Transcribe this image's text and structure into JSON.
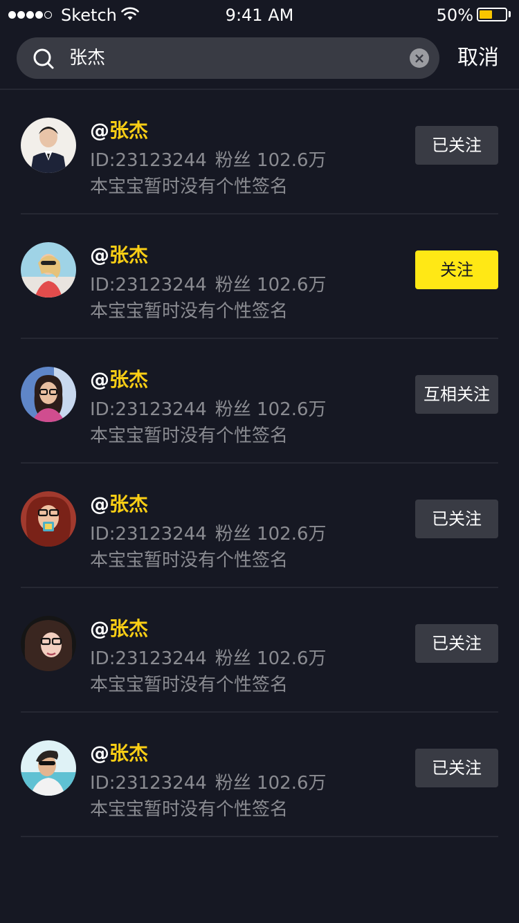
{
  "status_bar": {
    "carrier": "Sketch",
    "time": "9:41 AM",
    "battery_percent": "50%",
    "battery_level": 0.5,
    "signal_bars_filled": 4,
    "signal_bars_total": 5
  },
  "search": {
    "query": "张杰",
    "cancel_label": "取消",
    "icons": {
      "search": "search-icon",
      "clear": "clear-icon"
    }
  },
  "colors": {
    "background": "#161823",
    "accent_yellow": "#FFE815",
    "name_yellow": "#FACE15",
    "button_gray": "#393B44",
    "meta_gray": "#8A8B91"
  },
  "users": [
    {
      "at": "@",
      "name": "张杰",
      "id_text": "ID:23123244",
      "fans_text": "粉丝 102.6万",
      "signature": "本宝宝暂时没有个性签名",
      "button": "已关注",
      "button_style": "secondary"
    },
    {
      "at": "@",
      "name": "张杰",
      "id_text": "ID:23123244",
      "fans_text": "粉丝 102.6万",
      "signature": "本宝宝暂时没有个性签名",
      "button": "关注",
      "button_style": "primary"
    },
    {
      "at": "@",
      "name": "张杰",
      "id_text": "ID:23123244",
      "fans_text": "粉丝 102.6万",
      "signature": "本宝宝暂时没有个性签名",
      "button": "互相关注",
      "button_style": "secondary"
    },
    {
      "at": "@",
      "name": "张杰",
      "id_text": "ID:23123244",
      "fans_text": "粉丝 102.6万",
      "signature": "本宝宝暂时没有个性签名",
      "button": "已关注",
      "button_style": "secondary"
    },
    {
      "at": "@",
      "name": "张杰",
      "id_text": "ID:23123244",
      "fans_text": "粉丝 102.6万",
      "signature": "本宝宝暂时没有个性签名",
      "button": "已关注",
      "button_style": "secondary"
    },
    {
      "at": "@",
      "name": "张杰",
      "id_text": "ID:23123244",
      "fans_text": "粉丝 102.6万",
      "signature": "本宝宝暂时没有个性签名",
      "button": "已关注",
      "button_style": "secondary"
    }
  ]
}
